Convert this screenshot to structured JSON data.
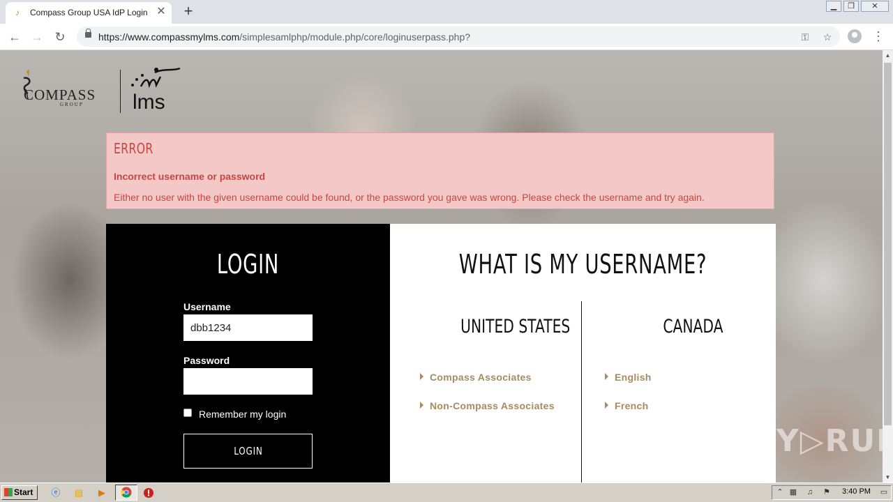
{
  "browser": {
    "tab_title": "Compass Group USA IdP Login",
    "close_tab_glyph": "✕",
    "new_tab_glyph": "+",
    "url_host": "https://www.compassmylms.com",
    "url_path": "/simplesamlphp/module.php/core/loginuserpass.php?",
    "back_glyph": "←",
    "forward_glyph": "→",
    "reload_glyph": "↻",
    "key_glyph": "⚿",
    "star_glyph": "☆",
    "menu_glyph": "⋮",
    "minimize_glyph": "▁",
    "restore_glyph": "❐",
    "close_glyph": "✕"
  },
  "logo": {
    "company": "COMPASS",
    "group": "GROUP",
    "product": "lms"
  },
  "error": {
    "title": "ERROR",
    "heading": "Incorrect username or password",
    "message": "Either no user with the given username could be found, or the password you gave was wrong. Please check the username and try again."
  },
  "login": {
    "title": "LOGIN",
    "username_label": "Username",
    "username_value": "dbb1234",
    "password_label": "Password",
    "password_value": "",
    "remember_label": "Remember my login",
    "button_label": "LOGIN"
  },
  "info": {
    "title": "WHAT IS MY USERNAME?",
    "us_heading": "UNITED STATES",
    "us_links": [
      "Compass Associates",
      "Non-Compass Associates"
    ],
    "canada_heading": "CANADA",
    "canada_links": [
      "English",
      "French"
    ],
    "link_color": "#a68b5f"
  },
  "watermark": "ANY▷RUN",
  "taskbar": {
    "start_label": "Start",
    "clock": "3:40 PM"
  }
}
